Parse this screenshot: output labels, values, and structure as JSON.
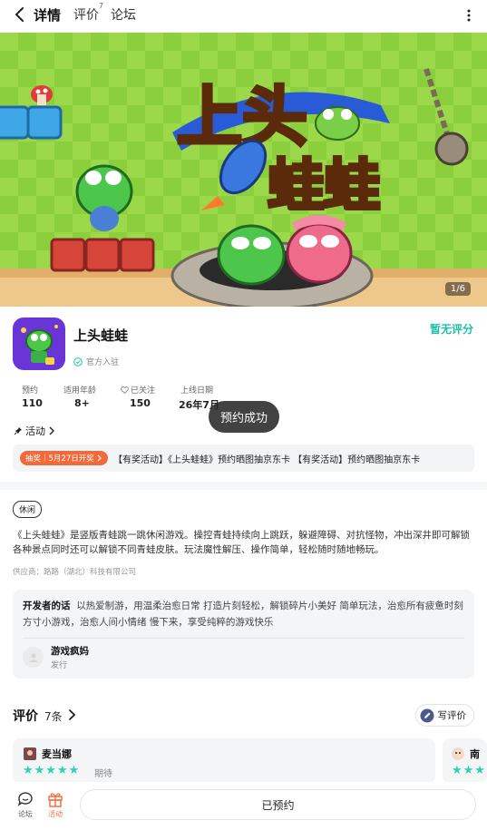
{
  "nav": {
    "tabs": [
      {
        "label": "详情",
        "active": true
      },
      {
        "label": "评价",
        "sup": "7"
      },
      {
        "label": "论坛"
      }
    ]
  },
  "banner": {
    "page_indicator": "1/6",
    "title_line1": "上头",
    "title_line2": "蛙蛙"
  },
  "app": {
    "name": "上头蛙蛙",
    "official_label": "官方入驻",
    "rating_label": "暂无评分",
    "stats": [
      {
        "label": "预约",
        "value": "110"
      },
      {
        "label": "适用年龄",
        "value": "8+"
      },
      {
        "label": "已关注",
        "value": "150"
      },
      {
        "label": "上线日期",
        "value": "26年7月"
      }
    ]
  },
  "toast": "预约成功",
  "activity": {
    "header": "活动",
    "badge": "抽奖｜5月27日开奖",
    "text": "【有奖活动】《上头蛙蛙》预约晒图抽京东卡 【有奖活动】预约晒图抽京东卡"
  },
  "details": {
    "tag": "休闲",
    "description": "《上头蛙蛙》是竖版青蛙跳一跳休闲游戏。操控青蛙持续向上跳跃，躲避障碍、对抗怪物，冲出深井即可解锁各种景点同时还可以解锁不同青蛙皮肤。玩法魔性解压、操作简单，轻松随时随地畅玩。",
    "supplier": "供应商：路路（湖北）科技有限公司"
  },
  "developer": {
    "words_label": "开发者的话",
    "words": "以热爱制游，用温柔治愈日常 打造片刻轻松，解锁碎片小美好 简单玩法，治愈所有疲惫时刻 方寸小游戏，治愈人间小情绪 慢下来，享受纯粹的游戏快乐",
    "name": "游戏疯妈",
    "role": "发行"
  },
  "reviews": {
    "title": "评价",
    "count": "7条",
    "write_label": "写评价",
    "items": [
      {
        "name": "麦当娜",
        "stars": "★★★★★",
        "tag": "期待"
      },
      {
        "name": "南",
        "stars": "★★★"
      }
    ]
  },
  "bottom_bar": {
    "forum_label": "论坛",
    "activity_label": "活动",
    "reserve_label": "已预约"
  },
  "colors": {
    "accent": "#1fbfa7",
    "badge": "#f26a3b",
    "star": "#2fd0b5"
  }
}
